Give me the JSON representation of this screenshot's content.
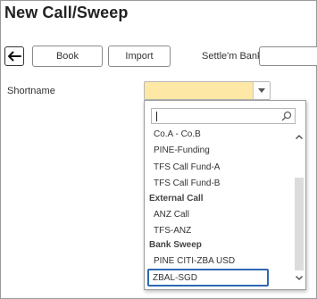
{
  "page": {
    "title": "New Call/Sweep"
  },
  "toolbar": {
    "back_icon": "arrow-left-icon",
    "book_label": "Book",
    "import_label": "Import",
    "settle_bank_label": "Settle'm Bank",
    "settle_bank_value": ""
  },
  "form": {
    "shortname_label": "Shortname",
    "shortname_value": ""
  },
  "dropdown": {
    "search_value": "",
    "search_icon": "search-icon",
    "items": [
      {
        "kind": "option",
        "label": "Co.A - Co.B"
      },
      {
        "kind": "option",
        "label": "PINE-Funding"
      },
      {
        "kind": "option",
        "label": "TFS Call Fund-A"
      },
      {
        "kind": "option",
        "label": "TFS Call Fund-B"
      },
      {
        "kind": "group",
        "label": "External Call"
      },
      {
        "kind": "option",
        "label": "ANZ Call"
      },
      {
        "kind": "option",
        "label": "TFS-ANZ"
      },
      {
        "kind": "group",
        "label": "Bank Sweep"
      },
      {
        "kind": "option",
        "label": "PINE CITI-ZBA USD"
      },
      {
        "kind": "option",
        "label": "ZBAL-SGD",
        "highlighted": true
      }
    ]
  },
  "colors": {
    "select_background": "#fde8a6",
    "focus_border": "#2f67b2",
    "scroll_track": "#dcdcdc"
  }
}
